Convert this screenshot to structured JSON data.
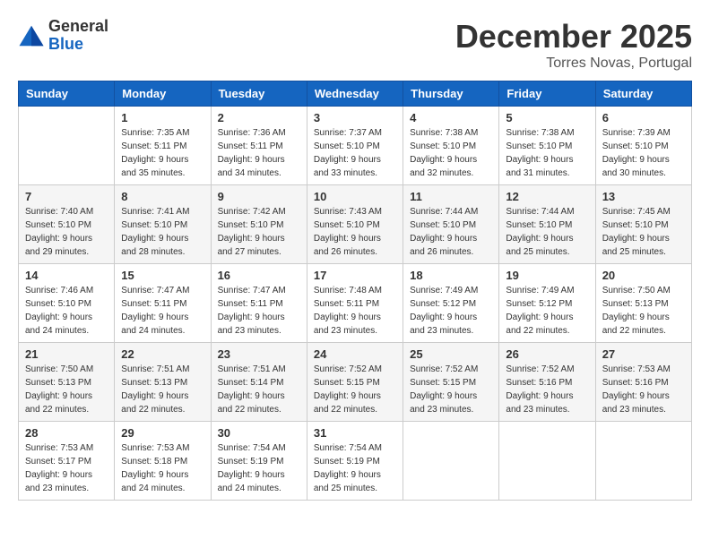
{
  "header": {
    "logo_general": "General",
    "logo_blue": "Blue",
    "title": "December 2025",
    "subtitle": "Torres Novas, Portugal"
  },
  "days_of_week": [
    "Sunday",
    "Monday",
    "Tuesday",
    "Wednesday",
    "Thursday",
    "Friday",
    "Saturday"
  ],
  "weeks": [
    [
      {
        "day": "",
        "info": ""
      },
      {
        "day": "1",
        "info": "Sunrise: 7:35 AM\nSunset: 5:11 PM\nDaylight: 9 hours\nand 35 minutes."
      },
      {
        "day": "2",
        "info": "Sunrise: 7:36 AM\nSunset: 5:11 PM\nDaylight: 9 hours\nand 34 minutes."
      },
      {
        "day": "3",
        "info": "Sunrise: 7:37 AM\nSunset: 5:10 PM\nDaylight: 9 hours\nand 33 minutes."
      },
      {
        "day": "4",
        "info": "Sunrise: 7:38 AM\nSunset: 5:10 PM\nDaylight: 9 hours\nand 32 minutes."
      },
      {
        "day": "5",
        "info": "Sunrise: 7:38 AM\nSunset: 5:10 PM\nDaylight: 9 hours\nand 31 minutes."
      },
      {
        "day": "6",
        "info": "Sunrise: 7:39 AM\nSunset: 5:10 PM\nDaylight: 9 hours\nand 30 minutes."
      }
    ],
    [
      {
        "day": "7",
        "info": "Sunrise: 7:40 AM\nSunset: 5:10 PM\nDaylight: 9 hours\nand 29 minutes."
      },
      {
        "day": "8",
        "info": "Sunrise: 7:41 AM\nSunset: 5:10 PM\nDaylight: 9 hours\nand 28 minutes."
      },
      {
        "day": "9",
        "info": "Sunrise: 7:42 AM\nSunset: 5:10 PM\nDaylight: 9 hours\nand 27 minutes."
      },
      {
        "day": "10",
        "info": "Sunrise: 7:43 AM\nSunset: 5:10 PM\nDaylight: 9 hours\nand 26 minutes."
      },
      {
        "day": "11",
        "info": "Sunrise: 7:44 AM\nSunset: 5:10 PM\nDaylight: 9 hours\nand 26 minutes."
      },
      {
        "day": "12",
        "info": "Sunrise: 7:44 AM\nSunset: 5:10 PM\nDaylight: 9 hours\nand 25 minutes."
      },
      {
        "day": "13",
        "info": "Sunrise: 7:45 AM\nSunset: 5:10 PM\nDaylight: 9 hours\nand 25 minutes."
      }
    ],
    [
      {
        "day": "14",
        "info": "Sunrise: 7:46 AM\nSunset: 5:10 PM\nDaylight: 9 hours\nand 24 minutes."
      },
      {
        "day": "15",
        "info": "Sunrise: 7:47 AM\nSunset: 5:11 PM\nDaylight: 9 hours\nand 24 minutes."
      },
      {
        "day": "16",
        "info": "Sunrise: 7:47 AM\nSunset: 5:11 PM\nDaylight: 9 hours\nand 23 minutes."
      },
      {
        "day": "17",
        "info": "Sunrise: 7:48 AM\nSunset: 5:11 PM\nDaylight: 9 hours\nand 23 minutes."
      },
      {
        "day": "18",
        "info": "Sunrise: 7:49 AM\nSunset: 5:12 PM\nDaylight: 9 hours\nand 23 minutes."
      },
      {
        "day": "19",
        "info": "Sunrise: 7:49 AM\nSunset: 5:12 PM\nDaylight: 9 hours\nand 22 minutes."
      },
      {
        "day": "20",
        "info": "Sunrise: 7:50 AM\nSunset: 5:13 PM\nDaylight: 9 hours\nand 22 minutes."
      }
    ],
    [
      {
        "day": "21",
        "info": "Sunrise: 7:50 AM\nSunset: 5:13 PM\nDaylight: 9 hours\nand 22 minutes."
      },
      {
        "day": "22",
        "info": "Sunrise: 7:51 AM\nSunset: 5:13 PM\nDaylight: 9 hours\nand 22 minutes."
      },
      {
        "day": "23",
        "info": "Sunrise: 7:51 AM\nSunset: 5:14 PM\nDaylight: 9 hours\nand 22 minutes."
      },
      {
        "day": "24",
        "info": "Sunrise: 7:52 AM\nSunset: 5:15 PM\nDaylight: 9 hours\nand 22 minutes."
      },
      {
        "day": "25",
        "info": "Sunrise: 7:52 AM\nSunset: 5:15 PM\nDaylight: 9 hours\nand 23 minutes."
      },
      {
        "day": "26",
        "info": "Sunrise: 7:52 AM\nSunset: 5:16 PM\nDaylight: 9 hours\nand 23 minutes."
      },
      {
        "day": "27",
        "info": "Sunrise: 7:53 AM\nSunset: 5:16 PM\nDaylight: 9 hours\nand 23 minutes."
      }
    ],
    [
      {
        "day": "28",
        "info": "Sunrise: 7:53 AM\nSunset: 5:17 PM\nDaylight: 9 hours\nand 23 minutes."
      },
      {
        "day": "29",
        "info": "Sunrise: 7:53 AM\nSunset: 5:18 PM\nDaylight: 9 hours\nand 24 minutes."
      },
      {
        "day": "30",
        "info": "Sunrise: 7:54 AM\nSunset: 5:19 PM\nDaylight: 9 hours\nand 24 minutes."
      },
      {
        "day": "31",
        "info": "Sunrise: 7:54 AM\nSunset: 5:19 PM\nDaylight: 9 hours\nand 25 minutes."
      },
      {
        "day": "",
        "info": ""
      },
      {
        "day": "",
        "info": ""
      },
      {
        "day": "",
        "info": ""
      }
    ]
  ]
}
